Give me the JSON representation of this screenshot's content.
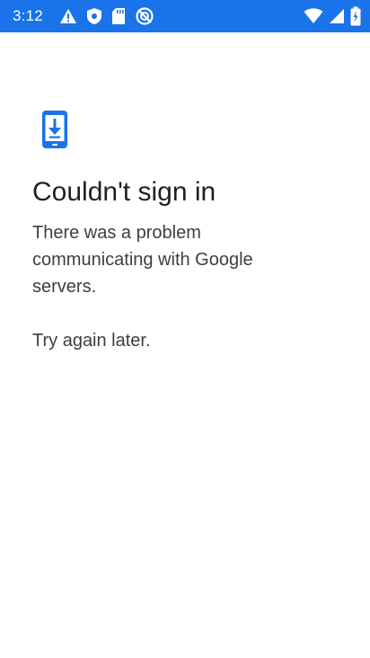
{
  "status_bar": {
    "time": "3:12",
    "background_color": "#1a73e8",
    "left_icons": [
      "warning-icon",
      "shield-icon",
      "sd-card-icon",
      "no-data-icon"
    ],
    "right_icons": [
      "wifi-icon",
      "cell-signal-icon",
      "battery-icon"
    ]
  },
  "screen": {
    "icon": "phone-download-icon",
    "accent_color": "#1a73e8",
    "title": "Couldn't sign in",
    "message": "There was a problem communicating with Google servers.",
    "retry_text": "Try again later."
  }
}
